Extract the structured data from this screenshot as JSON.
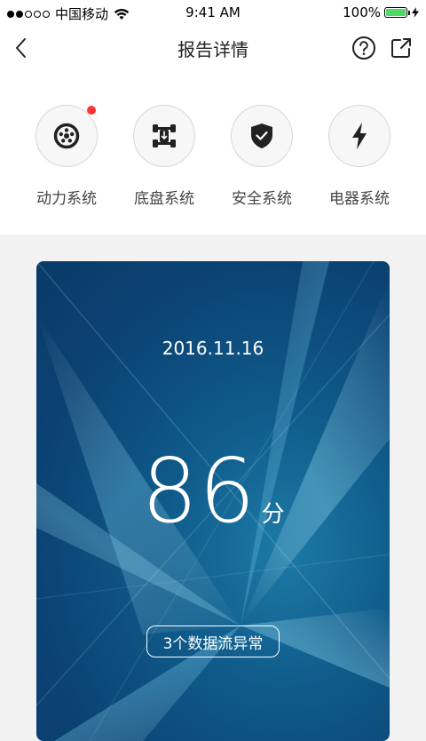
{
  "status_bar": {
    "carrier": "中国移动",
    "time": "9:41 AM",
    "battery": "100%",
    "battery_level": 1.0,
    "signal_bars_filled": 2,
    "signal_bars_total": 5
  },
  "nav": {
    "title": "报告详情",
    "back_icon": "chevron-left-icon",
    "help_icon": "question-circle-icon",
    "share_icon": "share-icon"
  },
  "systems": [
    {
      "label": "动力系统",
      "icon": "tire-icon",
      "has_alert": true
    },
    {
      "label": "底盘系统",
      "icon": "chassis-icon",
      "has_alert": false
    },
    {
      "label": "安全系统",
      "icon": "shield-check-icon",
      "has_alert": false
    },
    {
      "label": "电器系统",
      "icon": "lightning-icon",
      "has_alert": false
    }
  ],
  "report": {
    "date": "2016.11.16",
    "score": "86",
    "score_unit": "分",
    "anomaly_text": "3个数据流异常"
  },
  "colors": {
    "alert_dot": "#ff3333",
    "battery_fill": "#4cd964",
    "card_bg": "#0b4374"
  }
}
